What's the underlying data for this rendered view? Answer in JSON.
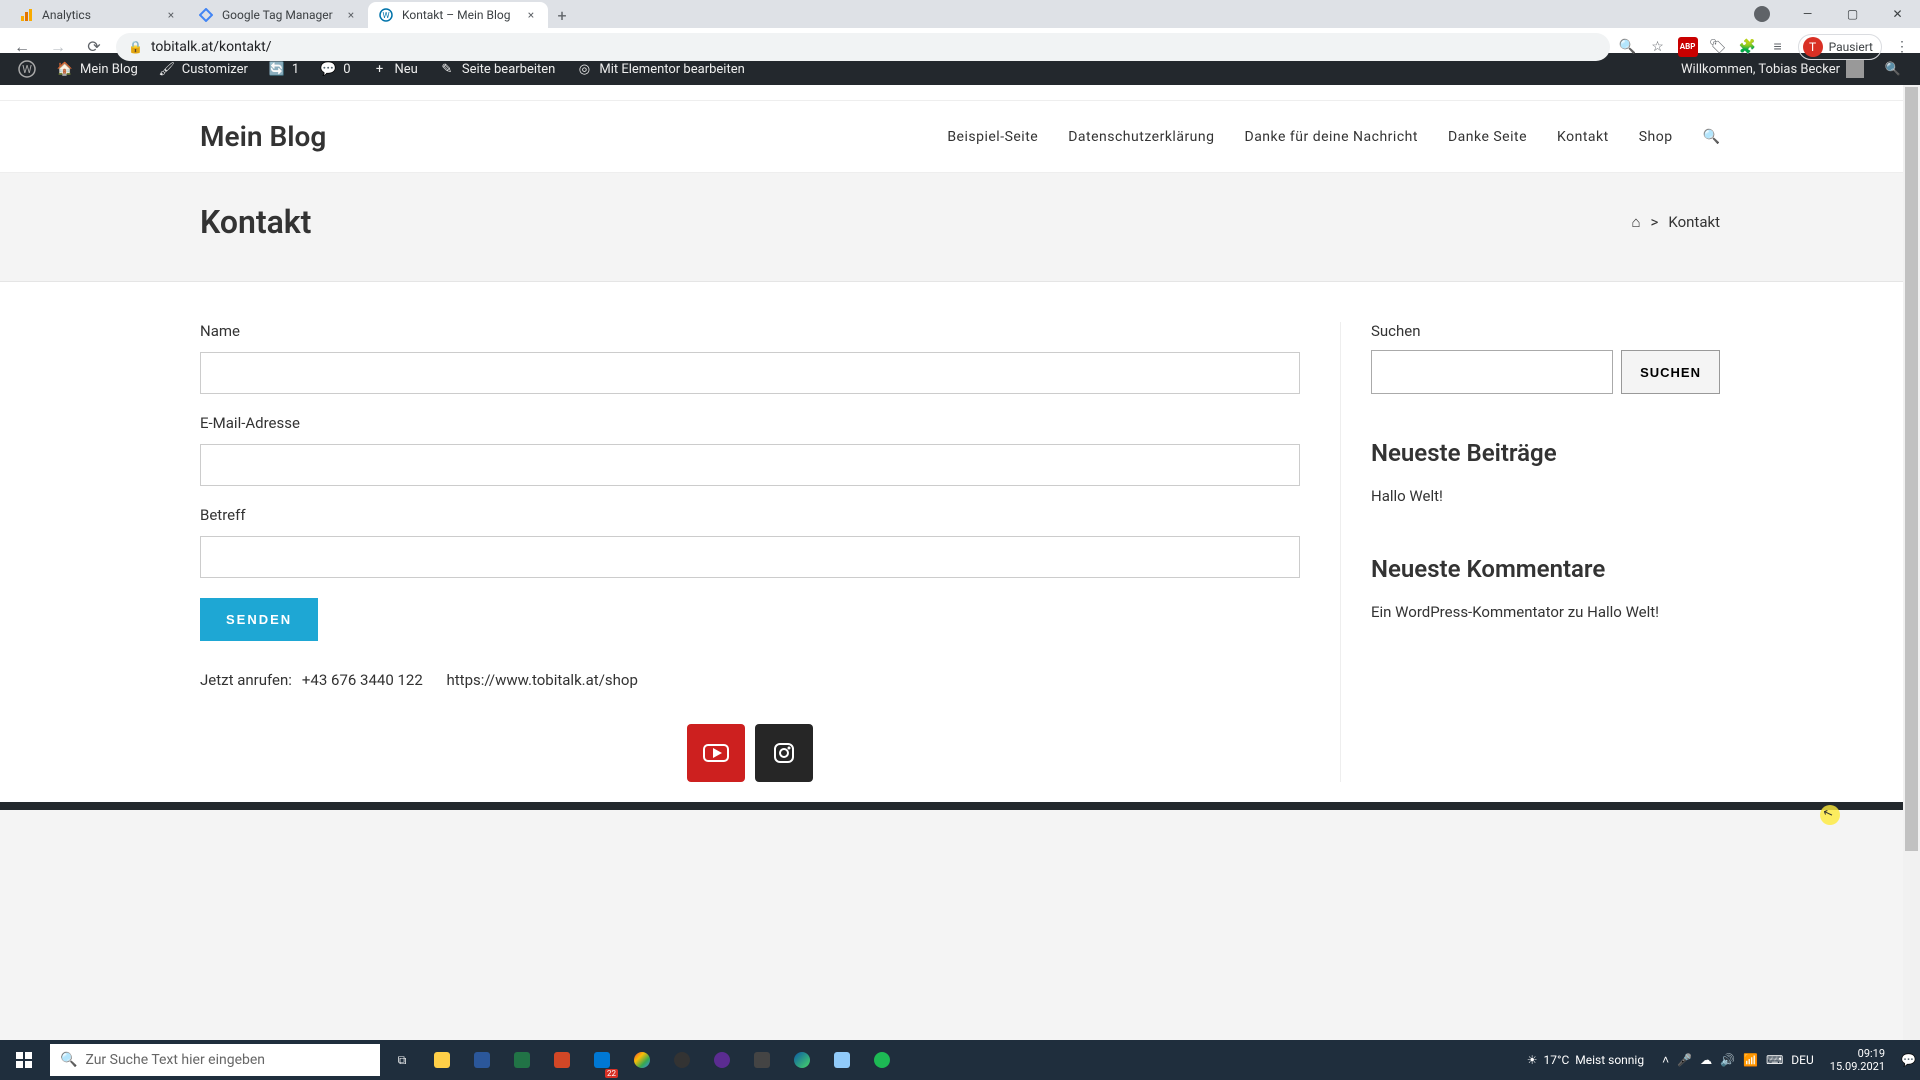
{
  "browser": {
    "tabs": [
      {
        "title": "Analytics",
        "favicon_color": "#f9ab00"
      },
      {
        "title": "Google Tag Manager",
        "favicon_color": "#4285f4"
      },
      {
        "title": "Kontakt – Mein Blog",
        "favicon_color": "#0073aa"
      }
    ],
    "url": "tobitalk.at/kontakt/",
    "profile_label": "Pausiert",
    "profile_initial": "T"
  },
  "wp_admin": {
    "site_name": "Mein Blog",
    "customizer": "Customizer",
    "updates": "1",
    "comments": "0",
    "new": "Neu",
    "edit_page": "Seite bearbeiten",
    "edit_elementor": "Mit Elementor bearbeiten",
    "welcome": "Willkommen, Tobias Becker"
  },
  "site": {
    "title": "Mein Blog",
    "nav": [
      "Beispiel-Seite",
      "Datenschutzerklärung",
      "Danke für deine Nachricht",
      "Danke Seite",
      "Kontakt",
      "Shop"
    ]
  },
  "page": {
    "title": "Kontakt",
    "breadcrumb_sep": ">",
    "breadcrumb_current": "Kontakt"
  },
  "form": {
    "name_label": "Name",
    "email_label": "E-Mail-Adresse",
    "subject_label": "Betreff",
    "submit_label": "SENDEN"
  },
  "contact_links": {
    "call_now": "Jetzt anrufen:",
    "phone": "+43 676 3440 122",
    "shop_url": "https://www.tobitalk.at/shop"
  },
  "sidebar": {
    "search_label": "Suchen",
    "search_button": "SUCHEN",
    "recent_posts_heading": "Neueste Beiträge",
    "recent_post": "Hallo Welt!",
    "recent_comments_heading": "Neueste Kommentare",
    "recent_comment": "Ein WordPress-Kommentator zu Hallo Welt!"
  },
  "taskbar": {
    "search_placeholder": "Zur Suche Text hier eingeben",
    "weather_temp": "17°C",
    "weather_text": "Meist sonnig",
    "lang": "DEU",
    "time": "09:19",
    "date": "15.09.2021",
    "calendar_badge": "22"
  }
}
